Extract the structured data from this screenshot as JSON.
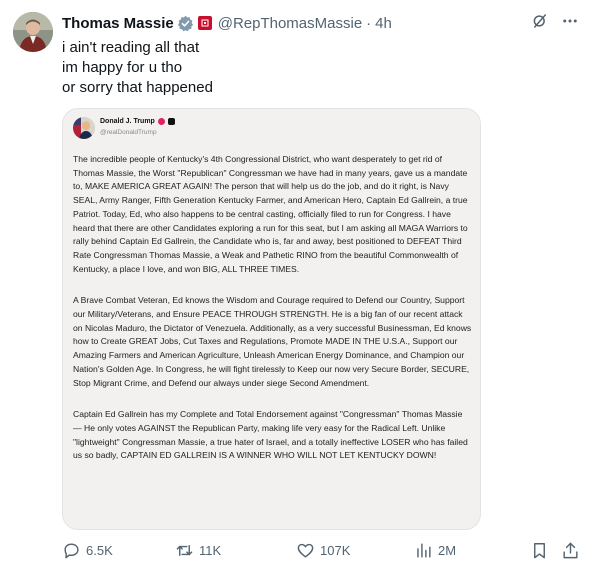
{
  "tweet": {
    "author_name": "Thomas Massie",
    "handle": "@RepThomasMassie",
    "separator": "·",
    "time": "4h",
    "lines": [
      "i ain't reading all that",
      "im happy for u tho",
      "or sorry that happened"
    ]
  },
  "embedded_post": {
    "author_name": "Donald J. Trump",
    "handle": "@realDonaldTrump",
    "paragraphs": [
      "The incredible people of Kentucky's 4th Congressional District, who want desperately to get rid of Thomas Massie, the Worst \"Republican\" Congressman we have had in many years, gave us a mandate to, MAKE AMERICA GREAT AGAIN! The person that will help us do the job, and do it right, is Navy SEAL, Army Ranger, Fifth Generation Kentucky Farmer, and American Hero, Captain Ed Gallrein, a true Patriot. Today, Ed, who also happens to be central casting, officially filed to run for Congress. I have heard that there are other Candidates exploring a run for this seat, but I am asking all MAGA Warriors to rally behind Captain Ed Gallrein, the Candidate who is, far and away, best positioned to DEFEAT Third Rate Congressman Thomas Massie, a Weak and Pathetic RINO from the beautiful Commonwealth of Kentucky, a place I love, and won BIG, ALL THREE TIMES.",
      "A Brave Combat Veteran, Ed knows the Wisdom and Courage required to Defend our Country, Support our Military/Veterans, and Ensure PEACE THROUGH STRENGTH. He is a big fan of our recent attack on Nicolas Maduro, the Dictator of Venezuela. Additionally, as a very successful Businessman, Ed knows how to Create GREAT Jobs, Cut Taxes and Regulations, Promote MADE IN THE U.S.A., Support our Amazing Farmers and American Agriculture, Unleash American Energy Dominance, and Champion our Nation's Golden Age. In Congress, he will fight tirelessly to Keep our now very Secure Border, SECURE, Stop Migrant Crime, and Defend our always under siege Second Amendment.",
      "Captain Ed Gallrein has my Complete and Total Endorsement against \"Congressman\" Thomas Massie — He only votes AGAINST the Republican Party, making life very easy for the Radical Left. Unlike \"lightweight\" Congressman Massie, a true hater of Israel, and a totally ineffective LOSER who has failed us so badly, CAPTAIN ED GALLREIN IS A WINNER WHO WILL NOT LET KENTUCKY DOWN!"
    ]
  },
  "metrics": {
    "replies": "6.5K",
    "reposts": "11K",
    "likes": "107K",
    "views": "2M"
  },
  "icons": {
    "verified": "verified-badge-icon",
    "grok": "grok-icon",
    "more": "more-icon",
    "reply": "reply-icon",
    "repost": "repost-icon",
    "like": "heart-icon",
    "views": "views-icon",
    "bookmark": "bookmark-icon",
    "share": "share-icon"
  },
  "colors": {
    "verified": "#829aab",
    "flag": "#c8102e",
    "text": "#0f1419",
    "muted": "#536471"
  }
}
